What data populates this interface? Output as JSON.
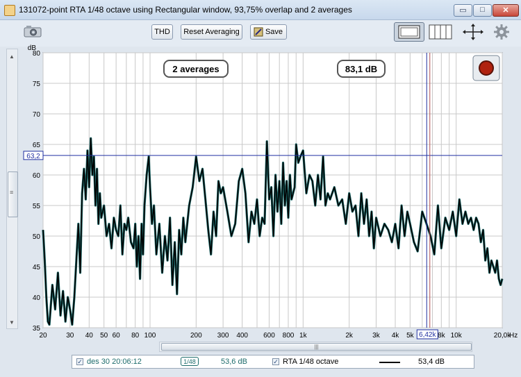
{
  "window": {
    "title": "131072-point RTA 1/48 octave using Rectangular window, 93,75% overlap and 2 averages",
    "min_glyph": "▭",
    "max_glyph": "□",
    "close_glyph": "✕"
  },
  "toolbar": {
    "thd_label": "THD",
    "reset_label": "Reset Averaging",
    "save_label": "Save"
  },
  "hscroll_grip": "|||",
  "vscroll_grip": "≡",
  "overlay": {
    "averages": "2 averages",
    "level": "83,1 dB"
  },
  "cursor": {
    "y_label": "63,2",
    "x_label": "6,42k",
    "y_value": 63.2,
    "x_value": 6420
  },
  "legend": {
    "row1_date": "des 30 20:06:12",
    "row1_badge": "1/48",
    "row1_value": "53,6 dB",
    "row2_name": "RTA 1/48 octave",
    "row2_value": "53,4 dB"
  },
  "colors": {
    "trace": "#000000",
    "trace_shadow": "#1c6b6b",
    "cursor": "#1f2fa0",
    "record_button": "#b0220f",
    "plot_bg": "#ffffff",
    "grid": "#c8c8c8"
  },
  "chart_data": {
    "type": "line",
    "xscale": "log",
    "xlim": [
      20,
      20000
    ],
    "ylim": [
      35,
      80
    ],
    "ylabel": "dB",
    "xlabel": "Hz",
    "grid": true,
    "y_ticks": [
      "35",
      "40",
      "45",
      "50",
      "55",
      "60",
      "65",
      "70",
      "75",
      "80"
    ],
    "x_ticks": [
      {
        "v": 20,
        "label": "20"
      },
      {
        "v": 30,
        "label": "30"
      },
      {
        "v": 40,
        "label": "40"
      },
      {
        "v": 50,
        "label": "50"
      },
      {
        "v": 60,
        "label": "60"
      },
      {
        "v": 80,
        "label": "80"
      },
      {
        "v": 100,
        "label": "100"
      },
      {
        "v": 200,
        "label": "200"
      },
      {
        "v": 300,
        "label": "300"
      },
      {
        "v": 400,
        "label": "400"
      },
      {
        "v": 600,
        "label": "600"
      },
      {
        "v": 800,
        "label": "800"
      },
      {
        "v": 1000,
        "label": "1k"
      },
      {
        "v": 2000,
        "label": "2k"
      },
      {
        "v": 3000,
        "label": "3k"
      },
      {
        "v": 4000,
        "label": "4k"
      },
      {
        "v": 5000,
        "label": "5k"
      },
      {
        "v": 8000,
        "label": "8k"
      },
      {
        "v": 10000,
        "label": "10k"
      },
      {
        "v": 20000,
        "label": "20,0k"
      }
    ],
    "series": [
      {
        "name": "RTA 1/48 octave",
        "x": [
          20,
          20.5,
          21,
          21.5,
          22,
          23,
          24,
          25,
          26,
          27,
          28,
          29,
          30,
          31,
          32,
          33,
          34,
          35,
          36,
          37,
          38,
          39,
          40,
          41,
          42,
          43,
          44,
          45,
          46,
          47,
          48,
          50,
          52,
          54,
          56,
          58,
          60,
          62,
          64,
          66,
          68,
          70,
          72,
          75,
          78,
          80,
          82,
          84,
          86,
          88,
          90,
          92,
          95,
          98,
          100,
          103,
          106,
          110,
          115,
          120,
          125,
          130,
          135,
          140,
          145,
          150,
          155,
          160,
          165,
          170,
          180,
          190,
          200,
          210,
          220,
          230,
          240,
          250,
          260,
          270,
          280,
          290,
          300,
          320,
          340,
          360,
          380,
          400,
          420,
          440,
          460,
          480,
          500,
          520,
          540,
          560,
          580,
          600,
          620,
          640,
          660,
          680,
          700,
          720,
          740,
          760,
          780,
          800,
          820,
          840,
          860,
          880,
          900,
          930,
          960,
          1000,
          1050,
          1100,
          1150,
          1200,
          1250,
          1300,
          1350,
          1400,
          1450,
          1500,
          1600,
          1700,
          1800,
          1900,
          2000,
          2100,
          2200,
          2300,
          2400,
          2500,
          2600,
          2700,
          2800,
          2900,
          3000,
          3200,
          3400,
          3600,
          3800,
          4000,
          4200,
          4400,
          4600,
          4800,
          5000,
          5300,
          5600,
          6000,
          6400,
          6800,
          7200,
          7600,
          8000,
          8500,
          9000,
          9500,
          10000,
          10500,
          11000,
          11500,
          12000,
          12500,
          13000,
          13500,
          14000,
          14500,
          15000,
          15500,
          16000,
          16500,
          17000,
          17500,
          18000,
          18500,
          19000,
          19500,
          20000
        ],
        "values": [
          51,
          46,
          40,
          36,
          35.5,
          42,
          38,
          44,
          37,
          41,
          36,
          40,
          38,
          35.5,
          40,
          46,
          52,
          44,
          57,
          61,
          56,
          64,
          58,
          66,
          60,
          63,
          55,
          61,
          52,
          57,
          53,
          55,
          50,
          52,
          48,
          53,
          51,
          50,
          55,
          47,
          52,
          51,
          53,
          49,
          48,
          52,
          45,
          50,
          43,
          52,
          47,
          55,
          60,
          63,
          58,
          52,
          55,
          47,
          52,
          44,
          50,
          46,
          53,
          42,
          49,
          40.5,
          51,
          47,
          53,
          49,
          55,
          58,
          63,
          59,
          61,
          56,
          51,
          47,
          54,
          50,
          59,
          57,
          58,
          54,
          50,
          52,
          59,
          61,
          57,
          49,
          54,
          52,
          56,
          50,
          53,
          52,
          65.5,
          56,
          58,
          50,
          60,
          54,
          59,
          52,
          62,
          55,
          59,
          53,
          60,
          56,
          57,
          58,
          65,
          62,
          63,
          64,
          57,
          60,
          59,
          55,
          60,
          56,
          63,
          55,
          57,
          56,
          58,
          55,
          56,
          52,
          57,
          54,
          55,
          50,
          57,
          52,
          56,
          50,
          54,
          48,
          53,
          50,
          52,
          51,
          49,
          52,
          48,
          55,
          50,
          54,
          52,
          49,
          47.5,
          54,
          52,
          50,
          47,
          55,
          48,
          53,
          51,
          54,
          50,
          56,
          52,
          54,
          52,
          53,
          51,
          53,
          52,
          49,
          51,
          46,
          48,
          44,
          46,
          45,
          44,
          46,
          43,
          42,
          43
        ]
      }
    ]
  }
}
